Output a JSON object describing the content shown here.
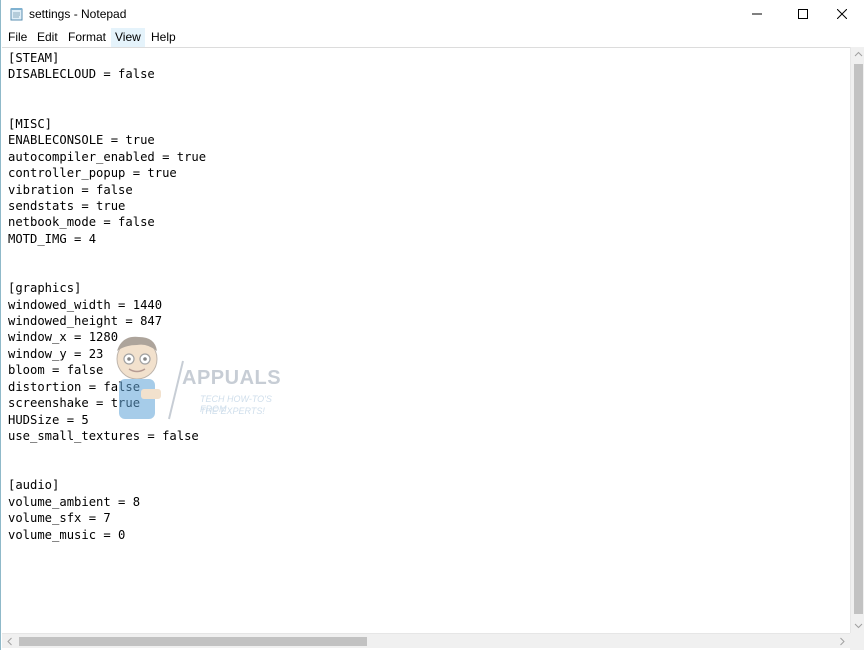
{
  "window": {
    "title": "settings - Notepad"
  },
  "menu": {
    "file": "File",
    "edit": "Edit",
    "format": "Format",
    "view": "View",
    "help": "Help"
  },
  "editor": {
    "lines": [
      "[STEAM]",
      "DISABLECLOUD = false",
      "",
      "",
      "[MISC]",
      "ENABLECONSOLE = true",
      "autocompiler_enabled = true",
      "controller_popup = true",
      "vibration = false",
      "sendstats = true",
      "netbook_mode = false",
      "MOTD_IMG = 4",
      "",
      "",
      "[graphics]",
      "windowed_width = 1440",
      "windowed_height = 847",
      "window_x = 1280",
      "window_y = 23",
      "bloom = false",
      "distortion = false",
      "screenshake = true",
      "HUDSize = 5",
      "use_small_textures = false",
      "",
      "",
      "[audio]",
      "volume_ambient = 8",
      "volume_sfx = 7",
      "volume_music = 0"
    ]
  },
  "watermark": {
    "title": "APPUALS",
    "line1": "TECH HOW-TO'S FROM",
    "line2": "THE EXPERTS!"
  },
  "icons": {
    "app": "notepad-icon",
    "minimize": "minimize-icon",
    "maximize": "maximize-icon",
    "close": "close-icon"
  },
  "colors": {
    "menu_hover": "#e5f3fb",
    "scrollbar_track": "#f0f0f0",
    "scrollbar_thumb": "#c2c2c2"
  }
}
